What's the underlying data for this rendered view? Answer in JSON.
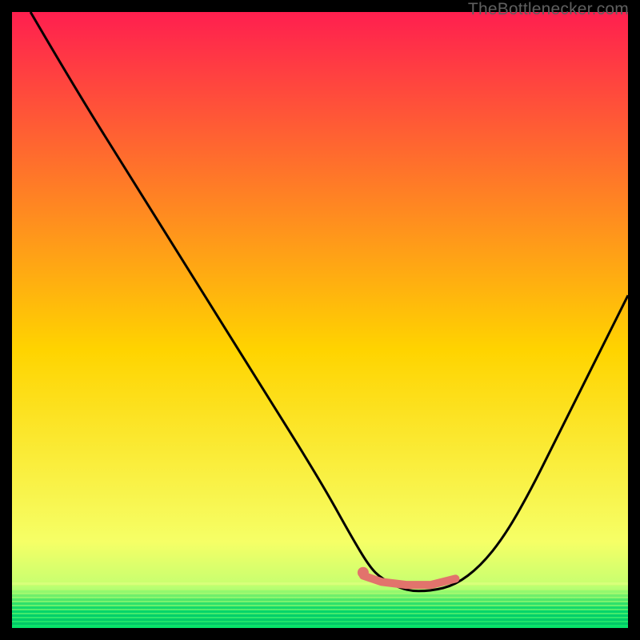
{
  "watermark": "TheBottlenecker.com",
  "colors": {
    "bg_black": "#000000",
    "grad_top": "#ff1f4f",
    "grad_mid": "#ffd400",
    "grad_low": "#f6ff66",
    "grad_green_light": "#c7ff70",
    "grad_green": "#00e06a",
    "curve": "#000000",
    "highlight": "#e2736c",
    "highlight_dot": "#e2736c"
  },
  "chart_data": {
    "type": "line",
    "title": "",
    "xlabel": "",
    "ylabel": "",
    "xlim": [
      0,
      100
    ],
    "ylim": [
      0,
      100
    ],
    "series": [
      {
        "name": "bottleneck-curve",
        "x": [
          3,
          10,
          20,
          30,
          40,
          50,
          55,
          58,
          60,
          64,
          68,
          72,
          76,
          80,
          84,
          88,
          92,
          96,
          100
        ],
        "y": [
          100,
          88,
          72,
          56,
          40,
          24,
          15,
          10,
          8,
          6,
          6,
          7,
          10,
          15,
          22,
          30,
          38,
          46,
          54
        ]
      },
      {
        "name": "highlight-flat-segment",
        "x": [
          57,
          60,
          64,
          68,
          72
        ],
        "y": [
          8.5,
          7.5,
          7,
          7,
          8
        ]
      }
    ],
    "highlight_point": {
      "x": 57,
      "y": 9
    }
  }
}
